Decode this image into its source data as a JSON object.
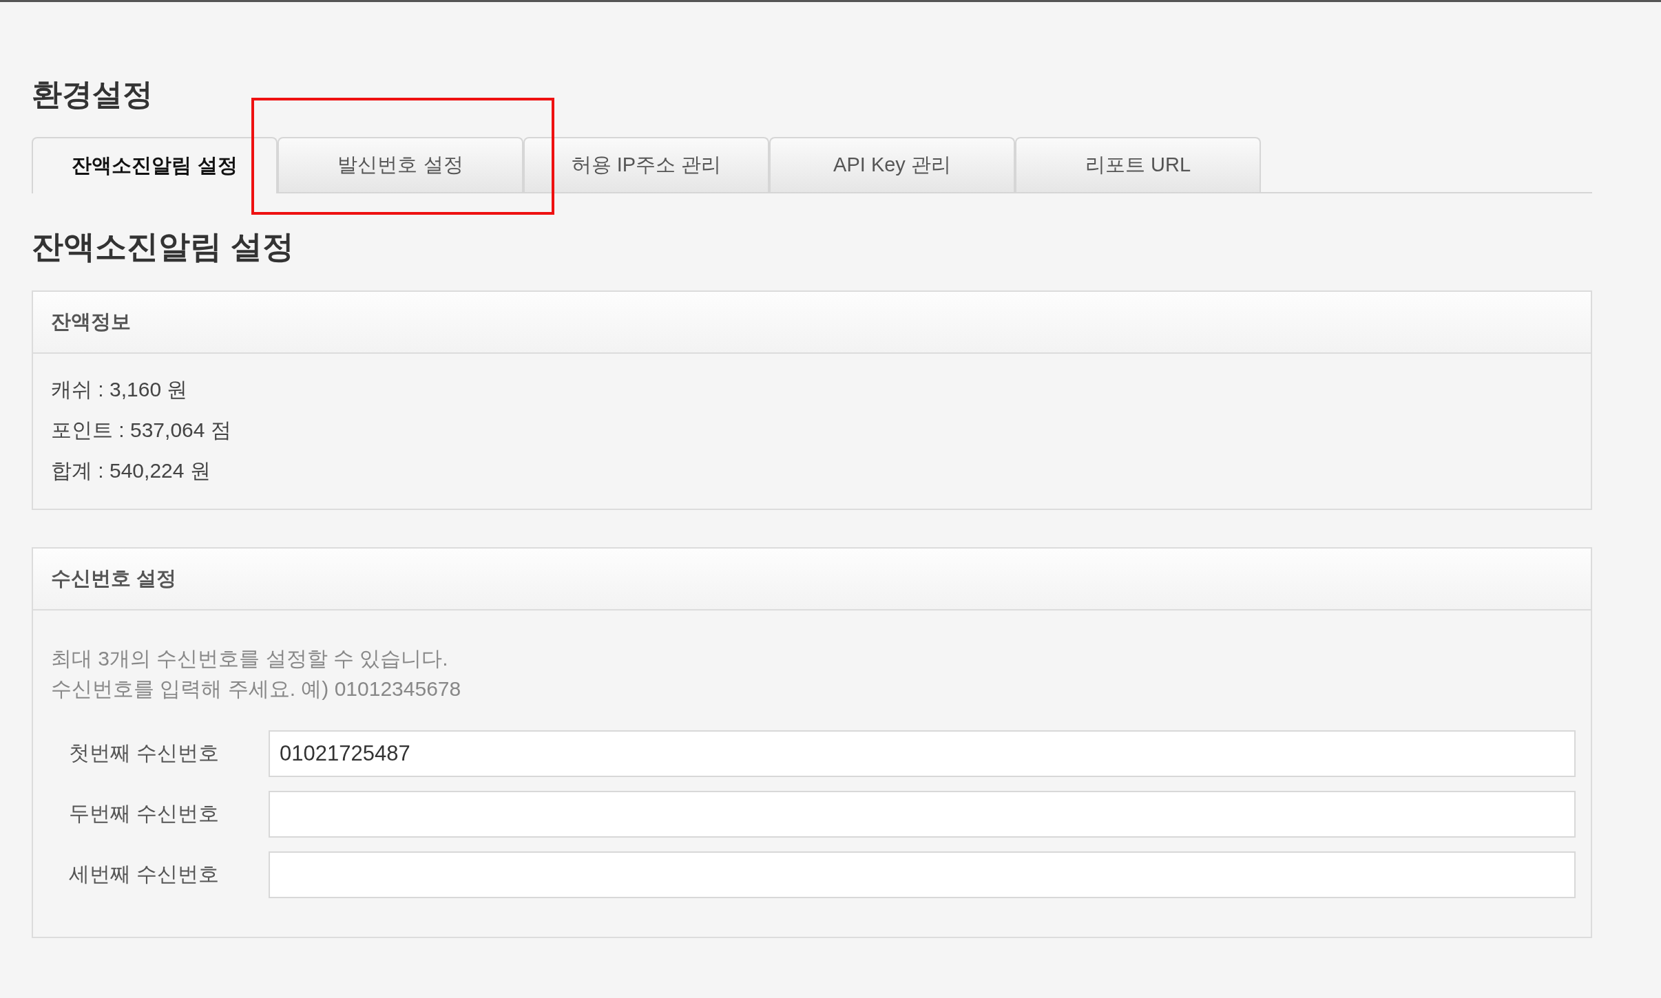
{
  "page_title": "환경설정",
  "tabs": [
    {
      "label": "잔액소진알림 설정",
      "selected": true
    },
    {
      "label": "발신번호 설정",
      "selected": false
    },
    {
      "label": "허용 IP주소 관리",
      "selected": false
    },
    {
      "label": "API Key 관리",
      "selected": false
    },
    {
      "label": "리포트 URL",
      "selected": false
    }
  ],
  "section_title": "잔액소진알림 설정",
  "balance_panel": {
    "title": "잔액정보",
    "lines": [
      "캐쉬 : 3,160 원",
      "포인트 : 537,064 점",
      "합계 : 540,224 원"
    ]
  },
  "recipient_panel": {
    "title": "수신번호 설정",
    "hints": [
      "최대 3개의 수신번호를 설정할 수 있습니다.",
      "수신번호를 입력해 주세요. 예) 01012345678"
    ],
    "fields": [
      {
        "label": "첫번째 수신번호",
        "value": "01021725487"
      },
      {
        "label": "두번째 수신번호"
      },
      {
        "label": "세번째 수신번호"
      }
    ]
  }
}
